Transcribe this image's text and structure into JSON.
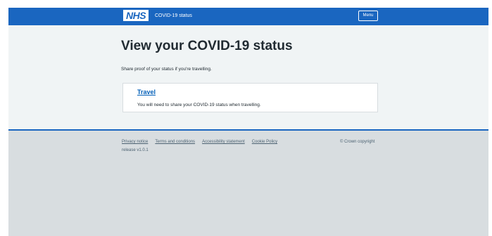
{
  "header": {
    "logo_text": "NHS",
    "service_name": "COVID-19 status",
    "menu_label": "Menu"
  },
  "main": {
    "title": "View your COVID-19 status",
    "lead": "Share proof of your status if you're travelling.",
    "cards": [
      {
        "link": "Travel",
        "description": "You will need to share your COVID-19 status when travelling."
      }
    ]
  },
  "footer": {
    "links": [
      "Privacy notice",
      "Terms and conditions",
      "Accessibility statement",
      "Cookie Policy"
    ],
    "release": "release v1.0.1",
    "copyright": "© Crown copyright"
  },
  "colors": {
    "header": "#1a66c0",
    "main_bg": "#f0f4f5",
    "footer_bg": "#d8dde0",
    "link": "#005eb8"
  }
}
